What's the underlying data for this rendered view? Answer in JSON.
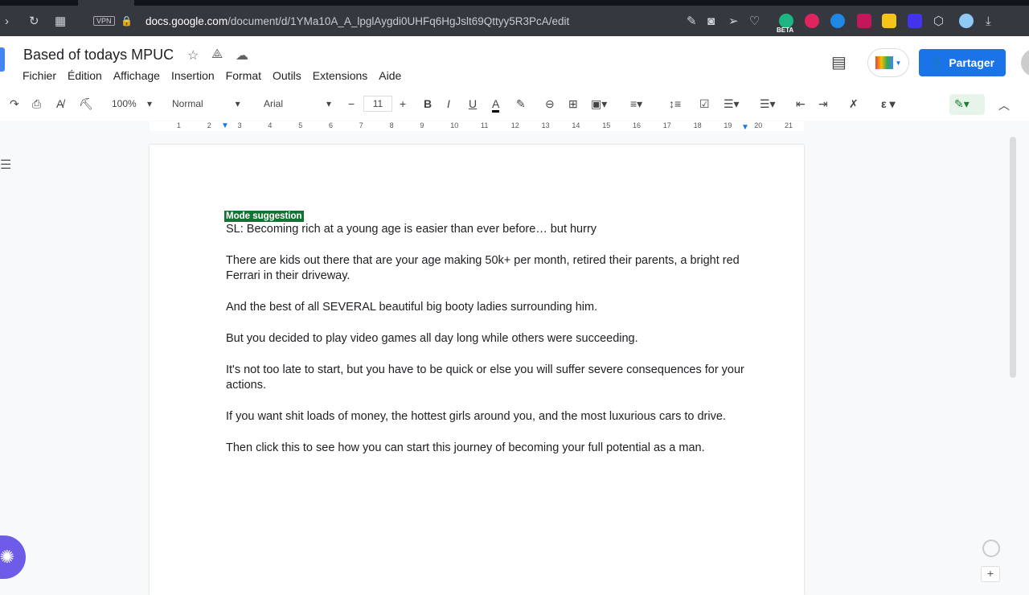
{
  "browser": {
    "url_host": "docs.google.com",
    "url_path": "/document/d/1YMa10A_A_lpglAygdi0UHFq6HgJslt69Qttyy5R3PcA/edit",
    "vpn": "VPN",
    "beta": "BETA"
  },
  "doc": {
    "title": "Based of todays MPUC"
  },
  "menu": [
    "Fichier",
    "Édition",
    "Affichage",
    "Insertion",
    "Format",
    "Outils",
    "Extensions",
    "Aide"
  ],
  "share_label": "Partager",
  "toolbar": {
    "zoom": "100%",
    "style": "Normal",
    "font": "Arial",
    "size": "11"
  },
  "ruler": [
    "1",
    "2",
    "3",
    "4",
    "5",
    "6",
    "7",
    "8",
    "9",
    "10",
    "11",
    "12",
    "13",
    "14",
    "15",
    "16",
    "17",
    "18",
    "19",
    "20",
    "21"
  ],
  "badge": "Mode suggestion",
  "paragraphs": [
    "SL: Becoming rich at a young age is easier than ever before… but hurry",
    "There are kids out there that are your age making 50k+ per month, retired their parents, a bright red Ferrari in their driveway.",
    "And the best of all SEVERAL beautiful big booty ladies surrounding him.",
    "But you decided to play video games all day long while others were succeeding.",
    "It's not too late to start, but you have to be quick or else you will suffer severe consequences for your actions.",
    "If you want shit loads of money, the hottest girls around you, and the most luxurious cars to drive.",
    "Then click this to see how you can start this journey of becoming your full potential as a man."
  ]
}
